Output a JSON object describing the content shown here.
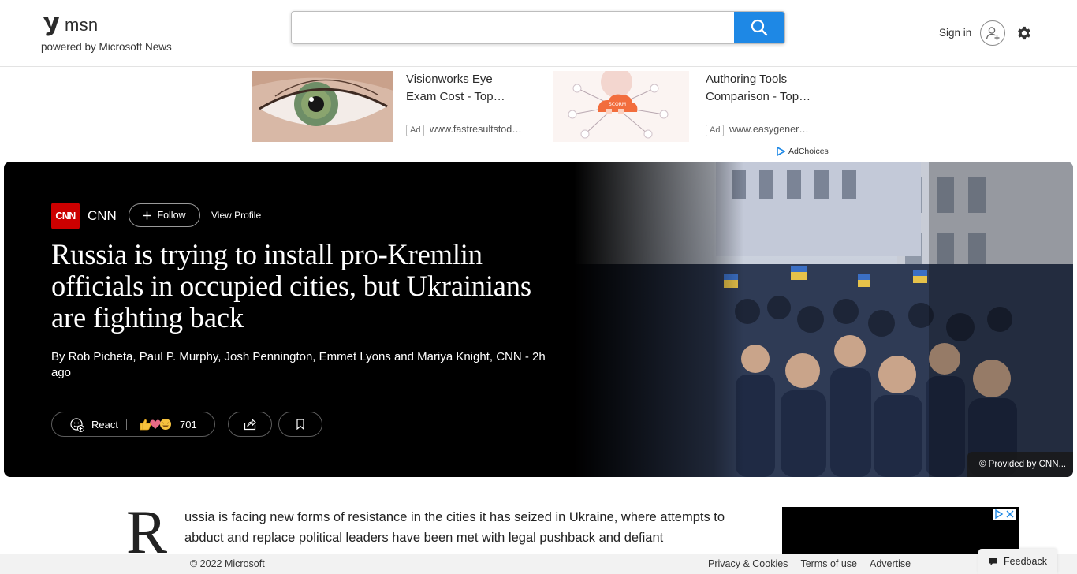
{
  "header": {
    "logo_text": "msn",
    "powered_by": "powered by Microsoft News",
    "search": {
      "value": "",
      "placeholder": ""
    },
    "sign_in": "Sign in"
  },
  "ads": [
    {
      "title": "Visionworks Eye Exam Cost - Top…",
      "tag": "Ad",
      "url": "www.fastresultstod…"
    },
    {
      "title": "Authoring Tools Comparison - Top…",
      "tag": "Ad",
      "url": "www.easygener…"
    }
  ],
  "ad_choices": "AdChoices",
  "hero": {
    "source_logo": "CNN",
    "source_name": "CNN",
    "follow_label": "Follow",
    "view_profile_label": "View Profile",
    "headline": "Russia is trying to install pro-Kremlin officials in occupied cities, but Ukrainians are fighting back",
    "byline": "By Rob Picheta, Paul P. Murphy, Josh Pennington, Emmet Lyons and Mariya Knight, CNN - 2h ago",
    "react_label": "React",
    "reaction_count": "701",
    "image_credit": "© Provided by CNN..."
  },
  "article": {
    "drop_cap": "R",
    "text": "ussia is facing new forms of resistance in the cities it has seized in Ukraine, where attempts to abduct and replace political leaders have been met with legal pushback and defiant"
  },
  "footer": {
    "copyright": "© 2022 Microsoft",
    "links": [
      "Privacy & Cookies",
      "Terms of use",
      "Advertise"
    ],
    "feedback": "Feedback"
  },
  "colors": {
    "search_button": "#1e88e5",
    "cnn_red": "#cc0000",
    "hero_bg": "#000000"
  },
  "icons": [
    "msn-logo-icon",
    "search-icon",
    "user-add-icon",
    "gear-icon",
    "adchoices-icon",
    "plus-icon",
    "react-icon",
    "like-icon",
    "heart-icon",
    "laugh-icon",
    "share-icon",
    "bookmark-icon",
    "ad-info-icon",
    "ad-close-icon",
    "feedback-icon"
  ]
}
